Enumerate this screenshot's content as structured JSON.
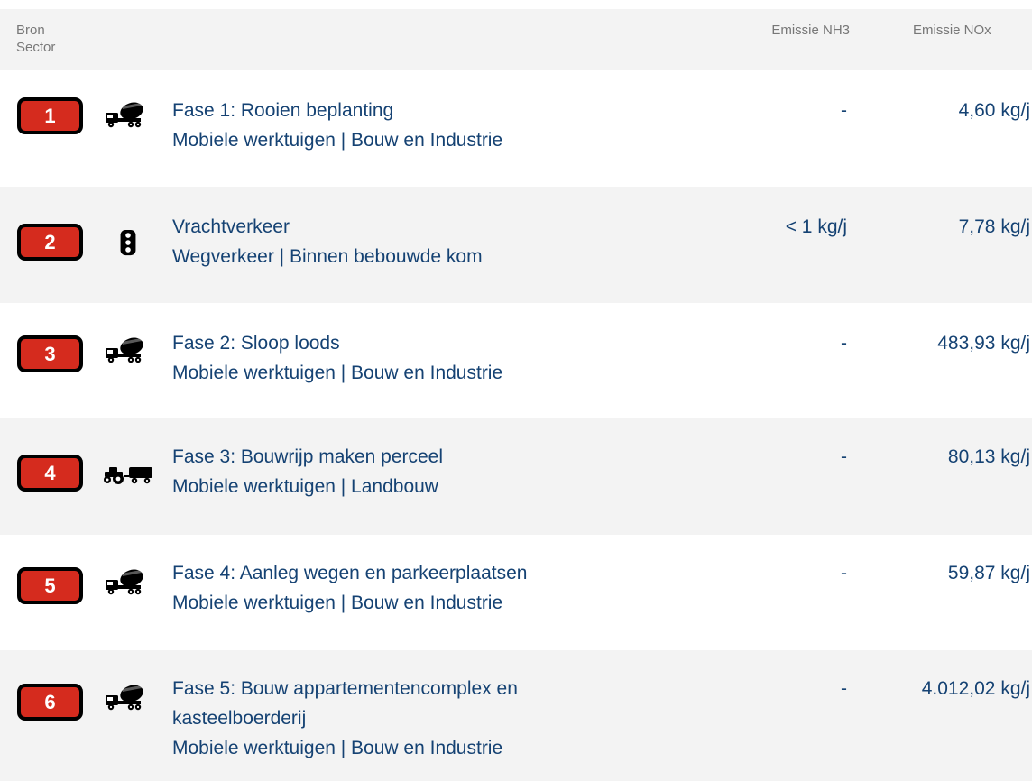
{
  "header": {
    "bron_label": "Bron",
    "sector_label": "Sector",
    "nh3_label": "Emissie NH3",
    "nox_label": "Emissie NOx"
  },
  "rows": [
    {
      "number": "1",
      "icon": "concrete-mixer-truck-icon",
      "title_line1": "Fase 1: Rooien beplanting",
      "title_line2": "",
      "sector": "Mobiele werktuigen | Bouw en Industrie",
      "nh3": "-",
      "nox": "4,60 kg/j"
    },
    {
      "number": "2",
      "icon": "traffic-light-icon",
      "title_line1": "Vrachtverkeer",
      "title_line2": "",
      "sector": "Wegverkeer | Binnen bebouwde kom",
      "nh3": "< 1 kg/j",
      "nox": "7,78 kg/j"
    },
    {
      "number": "3",
      "icon": "concrete-mixer-truck-icon",
      "title_line1": "Fase 2: Sloop loods",
      "title_line2": "",
      "sector": "Mobiele werktuigen | Bouw en Industrie",
      "nh3": "-",
      "nox": "483,93 kg/j"
    },
    {
      "number": "4",
      "icon": "tractor-icon",
      "title_line1": "Fase 3: Bouwrijp maken perceel",
      "title_line2": "",
      "sector": "Mobiele werktuigen | Landbouw",
      "nh3": "-",
      "nox": "80,13 kg/j"
    },
    {
      "number": "5",
      "icon": "concrete-mixer-truck-icon",
      "title_line1": "Fase 4: Aanleg wegen en parkeerplaatsen",
      "title_line2": "",
      "sector": "Mobiele werktuigen | Bouw en Industrie",
      "nh3": "-",
      "nox": "59,87 kg/j"
    },
    {
      "number": "6",
      "icon": "concrete-mixer-truck-icon",
      "title_line1": "Fase 5: Bouw appartementencomplex en",
      "title_line2": "kasteelboerderij",
      "sector": "Mobiele werktuigen | Bouw en Industrie",
      "nh3": "-",
      "nox": "4.012,02 kg/j"
    }
  ],
  "colors": {
    "badge_fill": "#d52b1e",
    "badge_border": "#000000",
    "text": "#154273",
    "header_text": "#777777",
    "row_alt_bg": "#f3f3f3"
  }
}
